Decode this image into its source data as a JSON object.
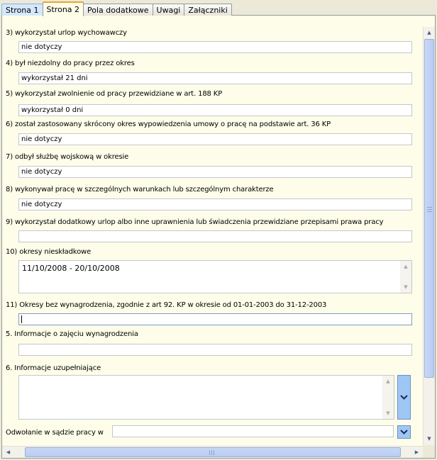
{
  "tabs": [
    {
      "label": "Strona 1"
    },
    {
      "label": "Strona 2"
    },
    {
      "label": "Pola dodatkowe"
    },
    {
      "label": "Uwagi"
    },
    {
      "label": "Załączniki"
    }
  ],
  "fields": {
    "f3": {
      "label": "3) wykorzystał urlop wychowawczy",
      "value": "nie dotyczy"
    },
    "f4": {
      "label": "4) był niezdolny do pracy przez okres",
      "value": "wykorzystał 21 dni"
    },
    "f5": {
      "label": "5) wykorzystał zwolnienie od pracy przewidziane w art. 188 KP",
      "value": "wykorzystał 0 dni"
    },
    "f6": {
      "label": "6) został zastosowany skrócony okres wypowiedzenia umowy o pracę na podstawie art. 36 KP",
      "value": "nie dotyczy"
    },
    "f7": {
      "label": "7) odbył służbę wojskową w okresie",
      "value": "nie dotyczy"
    },
    "f8": {
      "label": "8) wykonywał pracę w szczególnych warunkach lub szczególnym charakterze",
      "value": "nie dotyczy"
    },
    "f9": {
      "label": "9) wykorzystał dodatkowy urlop albo inne uprawnienia lub świadczenia przewidziane przepisami prawa pracy",
      "value": ""
    },
    "f10": {
      "label": "10) okresy nieskładkowe",
      "value": "11/10/2008 - 20/10/2008"
    },
    "f11": {
      "label": "11) Okresy bez wynagrodzenia, zgodnie z art 92. KP w okresie od 01-01-2003 do 31-12-2003",
      "value": ""
    },
    "i5": {
      "label": "5. Informacje o zajęciu wynagrodzenia",
      "value": ""
    },
    "i6": {
      "label": "6. Informacje uzupełniające",
      "value": ""
    },
    "court": {
      "label": "Odwołanie w sądzie pracy w",
      "value": ""
    }
  },
  "colors": {
    "dropdown_button": "#9ec7f5",
    "panel_background": "#fdfde9",
    "active_tab_accent": "#e8a72a"
  }
}
